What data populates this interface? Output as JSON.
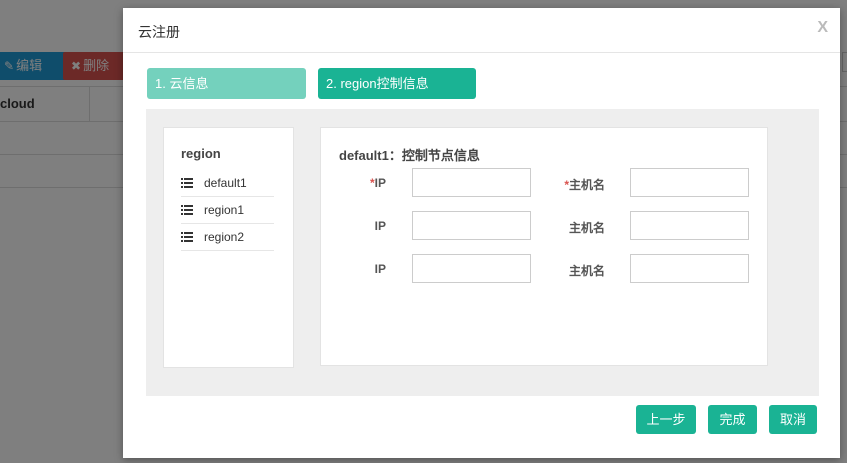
{
  "background": {
    "toolbar": {
      "edit_label": "编辑",
      "delete_label": "删除"
    },
    "table": {
      "column_header": "cloud"
    }
  },
  "modal": {
    "title": "云注册",
    "close_label": "X",
    "steps": [
      {
        "label": "1. 云信息"
      },
      {
        "label": "2. region控制信息"
      }
    ],
    "region_panel": {
      "title": "region",
      "items": [
        {
          "label": "default1"
        },
        {
          "label": "region1"
        },
        {
          "label": "region2"
        }
      ]
    },
    "form": {
      "title": "default1：控制节点信息",
      "required_mark": "*",
      "rows": [
        {
          "ip_label": "IP",
          "host_label": "主机名",
          "ip_value": "",
          "host_value": ""
        },
        {
          "ip_label": "IP",
          "host_label": "主机名",
          "ip_value": "",
          "host_value": ""
        },
        {
          "ip_label": "IP",
          "host_label": "主机名",
          "ip_value": "",
          "host_value": ""
        }
      ]
    },
    "buttons": {
      "prev": "上一步",
      "done": "完成",
      "cancel": "取消"
    }
  },
  "colors": {
    "accent": "#1ab394",
    "accent_light": "#74d1bd",
    "edit_button": "#1f9ad6",
    "delete_button": "#d9534f",
    "required": "#d9534f"
  }
}
